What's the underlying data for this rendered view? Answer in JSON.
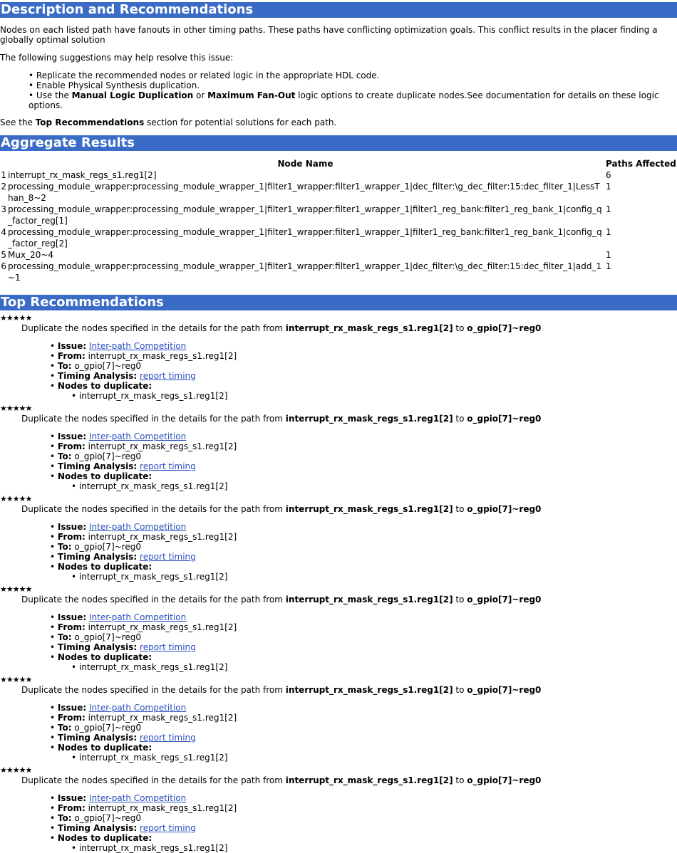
{
  "description": {
    "title": "Description and Recommendations",
    "intro": "Nodes on each listed path have fanouts in other timing paths. These paths have conflicting optimization goals. This conflict results in the placer finding a globally optimal solution",
    "suggestions_intro": "The following suggestions may help resolve this issue:",
    "suggestions": [
      "Replicate the recommended nodes or related logic in the appropriate HDL code.",
      "Enable Physical Synthesis duplication."
    ],
    "s3_a": "Use the ",
    "s3_b1": "Manual Logic Duplication",
    "s3_c": " or ",
    "s3_b2": "Maximum Fan-Out",
    "s3_d": " logic options to create duplicate nodes.See documentation for details on these logic options.",
    "see_a": "See the ",
    "see_b": "Top Recommendations",
    "see_c": " section for potential solutions for each path."
  },
  "aggregate": {
    "title": "Aggregate Results",
    "col_node": "Node Name",
    "col_paths": "Paths Affected",
    "rows": [
      {
        "n": "1",
        "node": "interrupt_rx_mask_regs_s1.reg1[2]",
        "paths": "6"
      },
      {
        "n": "2",
        "node": "processing_module_wrapper:processing_module_wrapper_1|filter1_wrapper:filter1_wrapper_1|dec_filter:\\g_dec_filter:15:dec_filter_1|LessThan_8~2",
        "paths": "1"
      },
      {
        "n": "3",
        "node": "processing_module_wrapper:processing_module_wrapper_1|filter1_wrapper:filter1_wrapper_1|filter1_reg_bank:filter1_reg_bank_1|config_q_factor_reg[1]",
        "paths": "1"
      },
      {
        "n": "4",
        "node": "processing_module_wrapper:processing_module_wrapper_1|filter1_wrapper:filter1_wrapper_1|filter1_reg_bank:filter1_reg_bank_1|config_q_factor_reg[2]",
        "paths": "1"
      },
      {
        "n": "5",
        "node": "Mux_20~4",
        "paths": "1"
      },
      {
        "n": "6",
        "node": "processing_module_wrapper:processing_module_wrapper_1|filter1_wrapper:filter1_wrapper_1|dec_filter:\\g_dec_filter:15:dec_filter_1|add_1~1",
        "paths": "1"
      }
    ]
  },
  "top": {
    "title": "Top Recommendations",
    "stars": "★★★★★",
    "desc_a": "Duplicate the nodes specified in the details for the path from ",
    "from_bold": "interrupt_rx_mask_regs_s1.reg1[2]",
    "desc_to": " to ",
    "to_bold": "o_gpio[7]~reg0",
    "issue_label": "Issue:",
    "issue_link": "Inter-path Competition",
    "from_label": "From:",
    "from_val": "interrupt_rx_mask_regs_s1.reg1[2]",
    "to_label": "To:",
    "to_val": "o_gpio[7]~reg0",
    "ta_label": "Timing Analysis:",
    "ta_link": "report timing",
    "dup_label": "Nodes to duplicate:",
    "dup_node": "interrupt_rx_mask_regs_s1.reg1[2]",
    "count": 6
  }
}
